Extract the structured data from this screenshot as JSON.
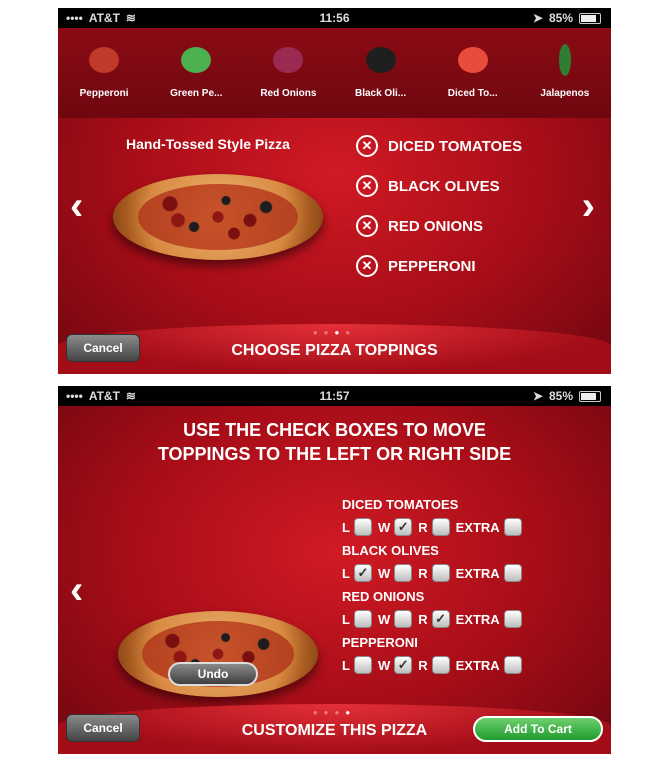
{
  "screen1": {
    "status": {
      "carrier": "AT&T",
      "time": "11:56",
      "battery": "85%"
    },
    "toppings": [
      {
        "label": "Pepperoni",
        "icon": "pepperoni-icon",
        "color": "#c0392b"
      },
      {
        "label": "Green Pe...",
        "icon": "green-pepper-icon",
        "color": "#4caf50"
      },
      {
        "label": "Red Onions",
        "icon": "red-onion-icon",
        "color": "#9b2a52"
      },
      {
        "label": "Black Oli...",
        "icon": "black-olive-icon",
        "color": "#1f1f1f"
      },
      {
        "label": "Diced To...",
        "icon": "tomato-icon",
        "color": "#e74c3c"
      },
      {
        "label": "Jalapenos",
        "icon": "jalapeno-icon",
        "color": "#2e7d32"
      }
    ],
    "pizza_title": "Hand-Tossed Style Pizza",
    "selected": [
      "DICED TOMATOES",
      "BLACK OLIVES",
      "RED ONIONS",
      "PEPPERONI"
    ],
    "nav": {
      "prev": "‹",
      "next": "›"
    },
    "footer_title": "CHOOSE PIZZA TOPPINGS",
    "cancel": "Cancel",
    "page_dots": 4,
    "active_dot": 3
  },
  "screen2": {
    "status": {
      "carrier": "AT&T",
      "time": "11:57",
      "battery": "85%"
    },
    "instructions": [
      "USE THE CHECK BOXES TO MOVE",
      "TOPPINGS TO THE LEFT OR RIGHT SIDE"
    ],
    "option_labels": {
      "left": "L",
      "whole": "W",
      "right": "R",
      "extra": "EXTRA"
    },
    "placements": [
      {
        "name": "DICED TOMATOES",
        "left": false,
        "whole": true,
        "right": false,
        "extra": false
      },
      {
        "name": "BLACK OLIVES",
        "left": true,
        "whole": false,
        "right": false,
        "extra": false
      },
      {
        "name": "RED ONIONS",
        "left": false,
        "whole": false,
        "right": true,
        "extra": false
      },
      {
        "name": "PEPPERONI",
        "left": false,
        "whole": true,
        "right": false,
        "extra": false
      }
    ],
    "undo": "Undo",
    "nav": {
      "prev": "‹"
    },
    "footer_title": "CUSTOMIZE THIS PIZZA",
    "cancel": "Cancel",
    "add_to_cart": "Add To Cart",
    "page_dots": 4,
    "active_dot": 4
  }
}
